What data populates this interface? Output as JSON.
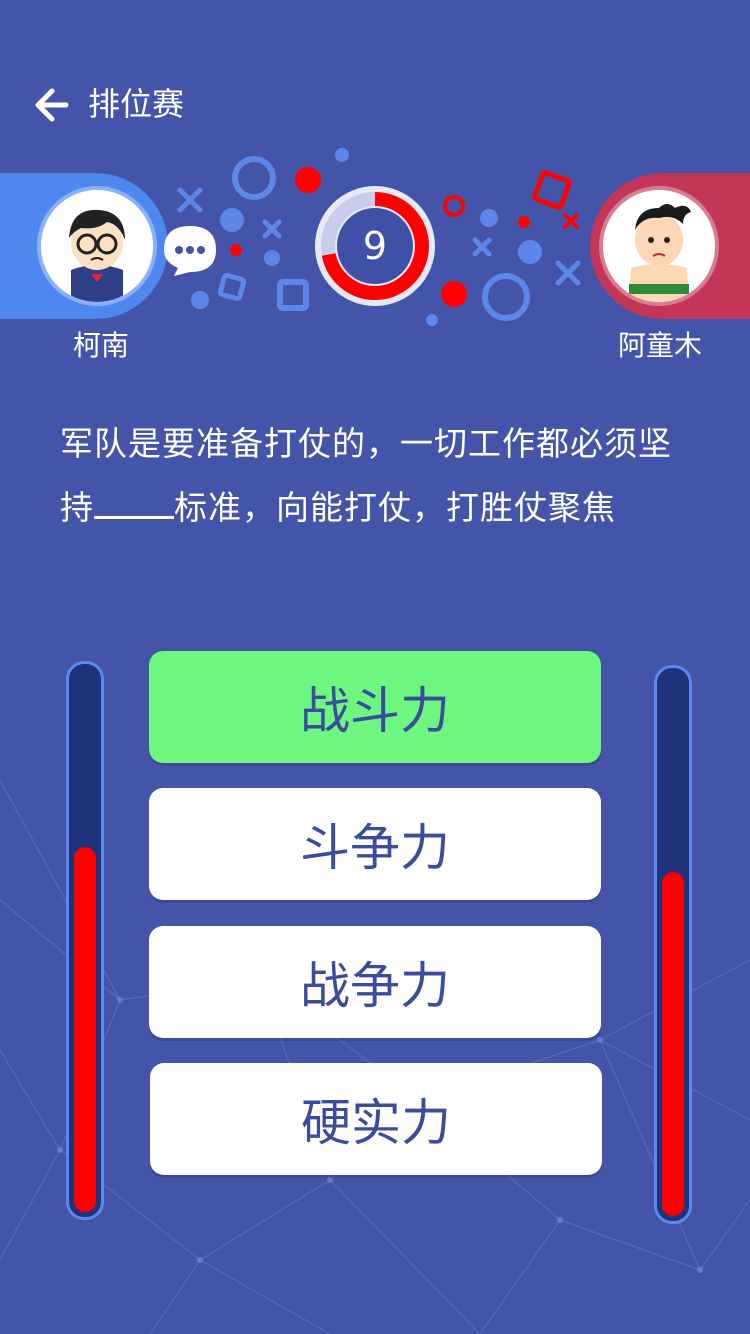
{
  "header": {
    "title": "排位赛",
    "back_icon": "arrow-left-icon"
  },
  "players": {
    "left": {
      "name": "柯南",
      "avatar": "conan-avatar",
      "bar_color": "#4e87ee",
      "score_fraction": 0.68
    },
    "right": {
      "name": "阿童木",
      "avatar": "astro-boy-avatar",
      "bar_color": "#c23658",
      "score_fraction": 0.64
    }
  },
  "timer": {
    "value": "9",
    "progress_fraction": 0.72,
    "ring_color": "#ff0000"
  },
  "question": {
    "part1": "军队是要准备打仗的，一切工作都必须坚持",
    "part2": "标准，向能打仗，打胜仗聚焦"
  },
  "options": [
    {
      "label": "战斗力",
      "selected": true
    },
    {
      "label": "斗争力",
      "selected": false
    },
    {
      "label": "战争力",
      "selected": false
    },
    {
      "label": "硬实力",
      "selected": false
    }
  ],
  "colors": {
    "background": "#4454a8",
    "selected_option": "#6ef77e",
    "option_text": "#3a4c9e"
  }
}
